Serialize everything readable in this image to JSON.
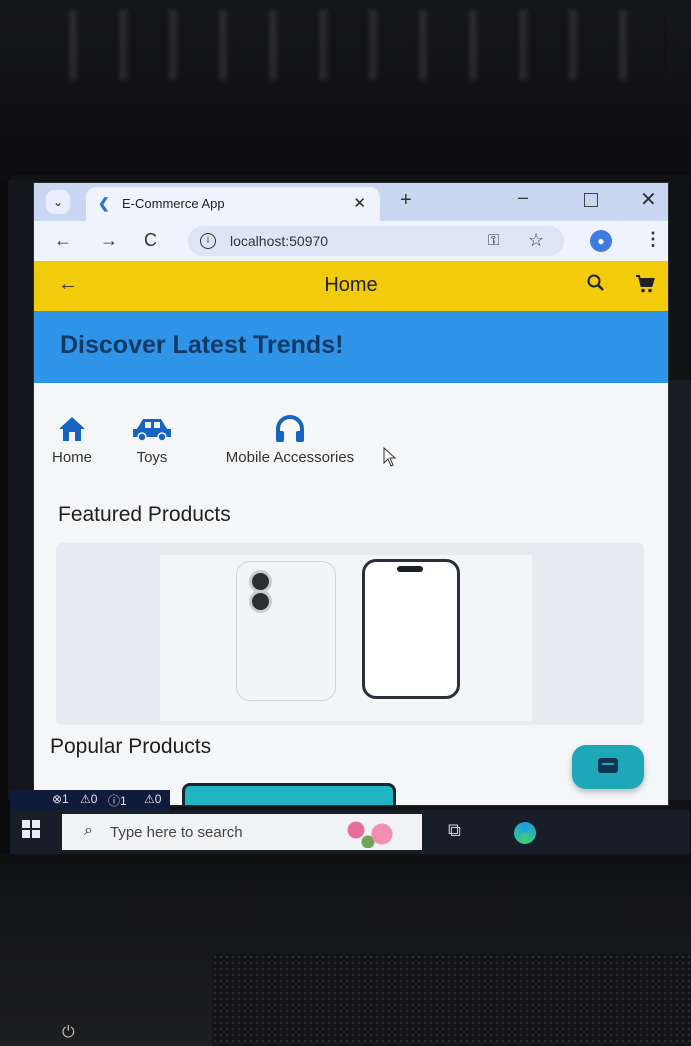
{
  "browser": {
    "tab_title": "E-Commerce App",
    "tab_close": "✕",
    "new_tab": "+",
    "url": "localhost:50970"
  },
  "app": {
    "title": "Home",
    "banner": "Discover Latest Trends!",
    "categories": [
      {
        "label": "Home",
        "icon": "house-icon"
      },
      {
        "label": "Toys",
        "icon": "car-icon"
      },
      {
        "label": "Mobile Accessories",
        "icon": "headphones-icon"
      }
    ],
    "featured_title": "Featured Products",
    "popular_title": "Popular Products",
    "accent_color": "#f2cc0a",
    "banner_color": "#2f93e8"
  },
  "ide_status": {
    "errors": "⊗1",
    "warnings": "⚠0",
    "info": "ⓘ1",
    "ports": "⚠0"
  },
  "taskbar": {
    "search_placeholder": "Type here to search"
  }
}
